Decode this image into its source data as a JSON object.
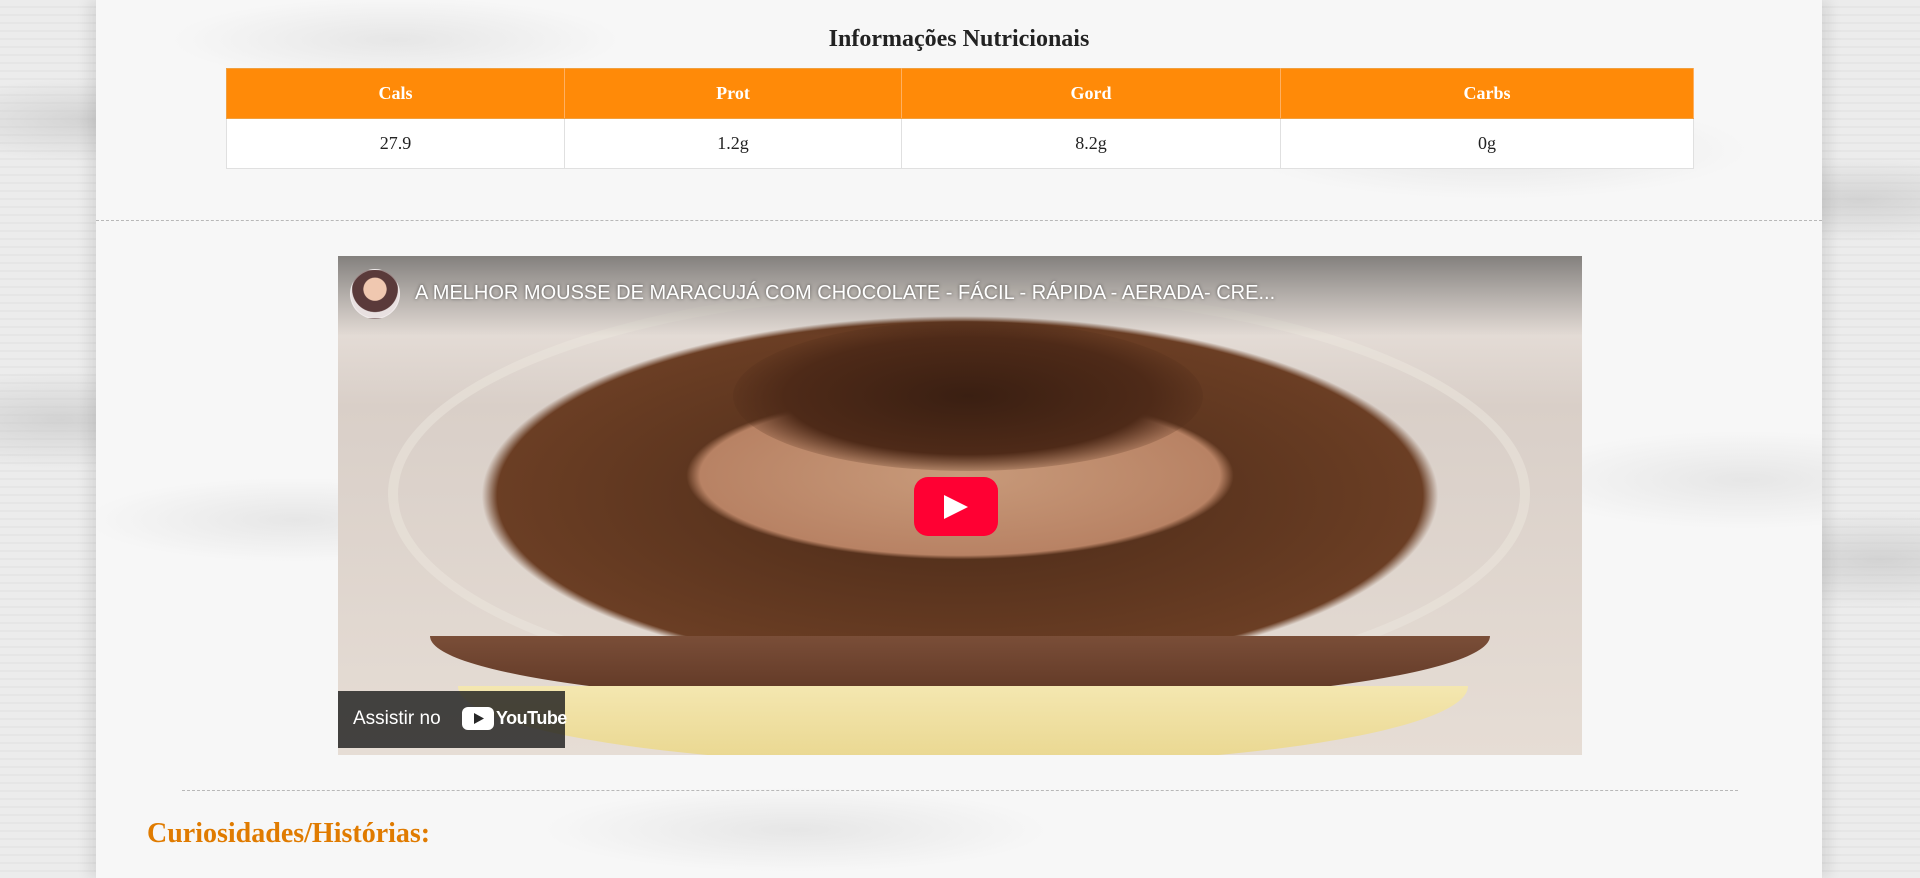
{
  "nutrition": {
    "title": "Informações Nutricionais",
    "headers": [
      "Cals",
      "Prot",
      "Gord",
      "Carbs"
    ],
    "values": [
      "27.9",
      "1.2g",
      "8.2g",
      "0g"
    ],
    "header_color": "#ff8a08"
  },
  "video": {
    "title": "A MELHOR MOUSSE DE MARACUJÁ COM CHOCOLATE - FÁCIL - RÁPIDA - AERADA- CRE...",
    "watch_label": "Assistir no",
    "platform": "YouTube",
    "play_color": "#ff0033"
  },
  "section": {
    "heading": "Curiosidades/Histórias:",
    "heading_color": "#e07b00"
  }
}
